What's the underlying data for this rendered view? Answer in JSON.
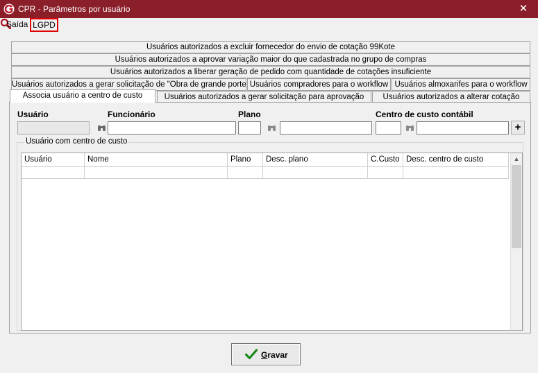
{
  "window": {
    "title": "CPR - Parâmetros por usuário",
    "close_label": "✕"
  },
  "menu": {
    "saida": "Saída",
    "lgpd": "LGPD"
  },
  "tabs": {
    "row1": "Usuários autorizados a excluir fornecedor do envio de cotação 99Kote",
    "row2": "Usuários autorizados a aprovar variação maior do que cadastrada no grupo de compras",
    "row3": "Usuários autorizados a liberar geração de pedido com quantidade de cotações insuficiente",
    "row4": [
      "Usuários autorizados a gerar solicitação de \"Obra de grande porte\"",
      "Usuários compradores para o workflow",
      "Usuários almoxarifes para o workflow"
    ],
    "row5": [
      "Associa usuário a centro de custo",
      "Usuários autorizados a gerar solicitação para aprovação",
      "Usuários autorizados a alterar cotação"
    ],
    "active": "Associa usuário a centro de custo"
  },
  "form": {
    "usuario_label": "Usuário",
    "funcionario_label": "Funcionário",
    "plano_label": "Plano",
    "centro_label": "Centro de custo contábil",
    "add_label": "+",
    "usuario_value": "",
    "funcionario_code": "",
    "funcionario_name": "",
    "plano_value": "",
    "plano_desc": "",
    "centro_code": "",
    "centro_desc": ""
  },
  "group": {
    "title": "Usuário com centro de custo",
    "columns": [
      "Usuário",
      "Nome",
      "Plano",
      "Desc. plano",
      "C.Custo",
      "Desc. centro de custo"
    ],
    "rows": []
  },
  "buttons": {
    "save_first": "G",
    "save_rest": "ravar"
  },
  "colors": {
    "titlebar": "#8a1f2a",
    "highlight": "#e00000",
    "check": "#1a8a1a"
  }
}
